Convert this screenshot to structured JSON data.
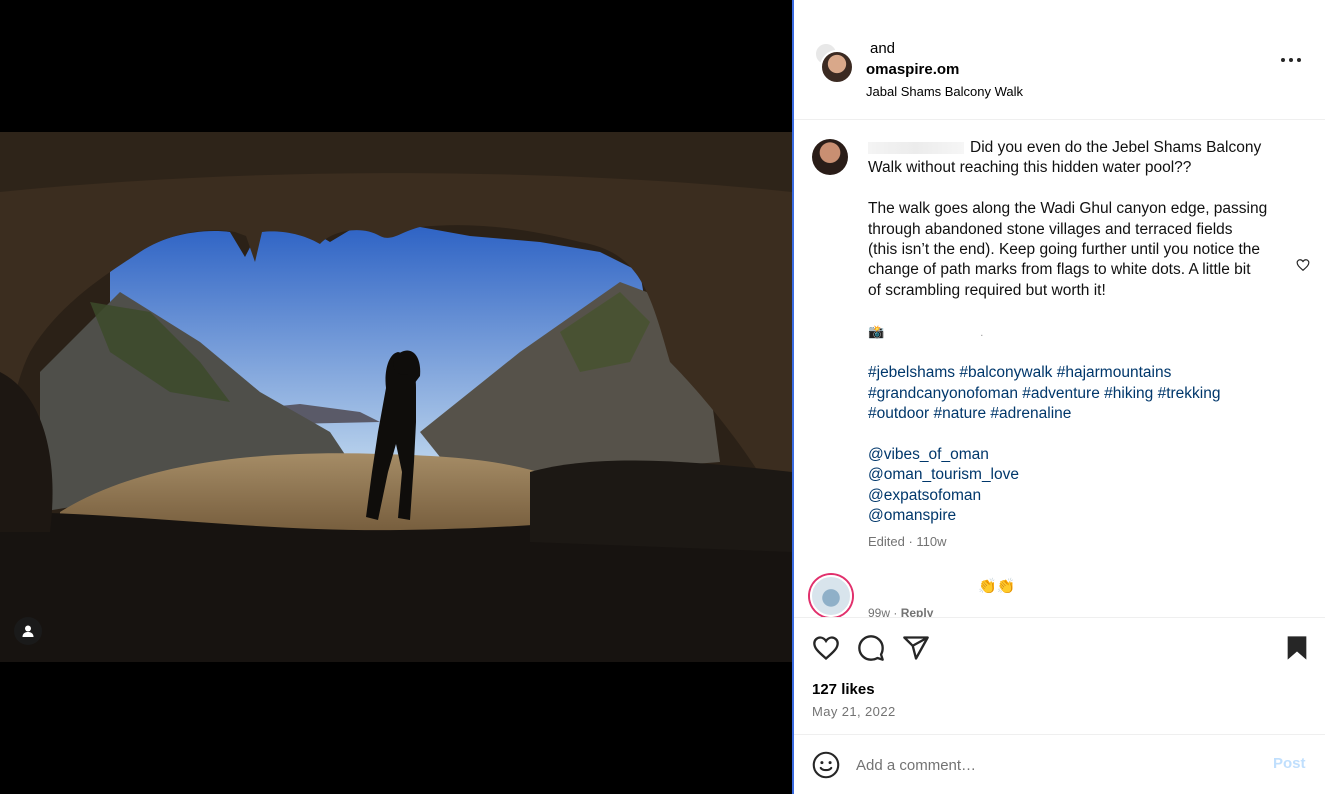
{
  "post": {
    "header": {
      "line1": "and",
      "username": "omaspire.om",
      "location": "Jabal Shams Balcony Walk"
    },
    "caption": {
      "first_line": "Did you even do the Jebel Shams Balcony",
      "second_line": "Walk without reaching this hidden water pool??",
      "paragraph_lines": [
        "The walk goes along the Wadi Ghul canyon edge, passing",
        "through abandoned stone villages and terraced fields",
        "(this isn’t the end). Keep going further until you notice the",
        "change of path marks from flags to white dots. A little bit",
        "of scrambling required but worth it!"
      ],
      "camera_emoji": "📸",
      "camera_suffix": ".",
      "hashtags": [
        [
          "#jebelshams",
          "#balconywalk",
          "#hajarmountains"
        ],
        [
          "#grandcanyonofoman",
          "#adventure",
          "#hiking",
          "#trekking"
        ],
        [
          "#outdoor",
          "#nature",
          "#adrenaline"
        ]
      ],
      "mentions": [
        "@vibes_of_oman",
        "@oman_tourism_love",
        "@expatsofoman",
        "@omanspire"
      ],
      "edited": "Edited · 110w"
    },
    "comment": {
      "emoji": "👏👏",
      "time": "99w",
      "separator": " · ",
      "reply_label": "Reply"
    },
    "likes": "127 likes",
    "date": "May 21, 2022",
    "composer": {
      "emoji_icon": "smiley-icon",
      "placeholder": "Add a comment…",
      "post_label": "Post"
    },
    "colors": {
      "link": "#00376b",
      "muted": "#737373",
      "post_disabled": "#c0dffd",
      "divider": "#3a6be0"
    }
  }
}
